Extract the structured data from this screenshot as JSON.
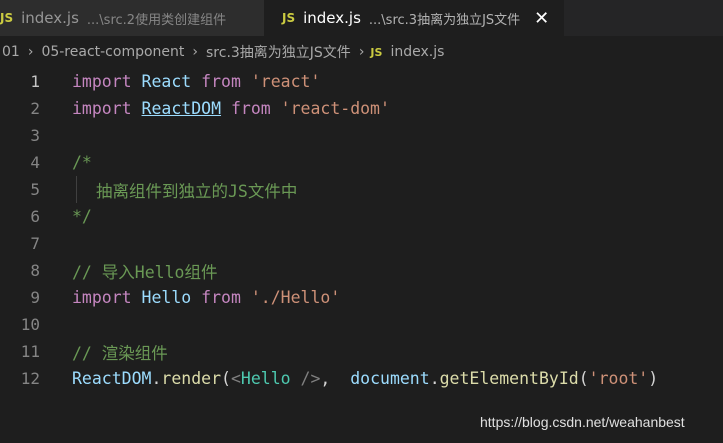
{
  "tabs": [
    {
      "js": "JS",
      "name": "index.js",
      "path": "...\\src.2使用类创建组件"
    },
    {
      "js": "JS",
      "name": "index.js",
      "path": "...\\src.3抽离为独立JS文件",
      "close": "✕"
    }
  ],
  "breadcrumb": {
    "seg0": "01",
    "seg1": "05-react-component",
    "seg2": "src.3抽离为独立JS文件",
    "file_js": "JS",
    "file": "index.js",
    "sep": "›"
  },
  "lines": {
    "n1": "1",
    "n2": "2",
    "n3": "3",
    "n4": "4",
    "n5": "5",
    "n6": "6",
    "n7": "7",
    "n8": "8",
    "n9": "9",
    "n10": "10",
    "n11": "11",
    "n12": "12",
    "l1_kw": "import",
    "l1_id": "React",
    "l1_from": "from",
    "l1_str": "'react'",
    "l2_kw": "import",
    "l2_id": "ReactDOM",
    "l2_from": "from",
    "l2_str": "'react-dom'",
    "l4": "/*",
    "l5": "抽离组件到独立的JS文件中",
    "l6": "*/",
    "l8": "// 导入Hello组件",
    "l9_kw": "import",
    "l9_id": "Hello",
    "l9_from": "from",
    "l9_str": "'./Hello'",
    "l11": "// 渲染组件",
    "l12_obj": "ReactDOM",
    "l12_dot": ".",
    "l12_fn": "render",
    "l12_open": "(",
    "l12_lt": "<",
    "l12_tag": "Hello",
    "l12_close": " />",
    "l12_comma": ",  ",
    "l12_doc": "document",
    "l12_dot2": ".",
    "l12_fn2": "getElementById",
    "l12_open2": "(",
    "l12_str": "'root'",
    "l12_end": ")"
  },
  "watermark": "https://blog.csdn.net/weahanbest"
}
